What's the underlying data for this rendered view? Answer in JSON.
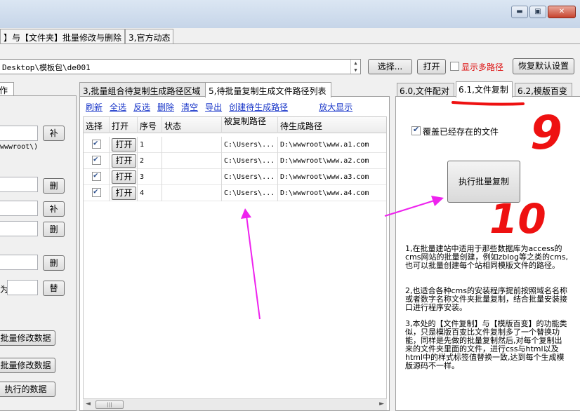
{
  "window": {
    "minimize": "▬",
    "restore": "▣",
    "close": "✕"
  },
  "main_tabs": [
    "】与【文件夹】批量修改与删除",
    "3,官方动态"
  ],
  "path": {
    "value": "Desktop\\模板包\\de001",
    "select_label": "选择...",
    "open_label": "打开",
    "multi_path_label": "显示多路径",
    "reset_label": "恢复默认设置"
  },
  "left": {
    "tab_label": "作",
    "hint": "wwwroot\\)",
    "btn_supplement": "补",
    "btn_delete": "删",
    "btn_replace": "替",
    "label_wei": "为",
    "btn_batch_modify_1": "批量修改数据",
    "btn_batch_modify_2": "批量修改数据",
    "btn_exec": "执行的数据"
  },
  "center": {
    "tabs": [
      "3,批量组合待复制生成路径区域",
      "5,待批量复制生成文件路径列表"
    ],
    "links": [
      "刷新",
      "全选",
      "反选",
      "删除",
      "清空",
      "导出",
      "创建待生成路径",
      "放大显示"
    ],
    "columns": [
      "选择",
      "打开",
      "序号",
      "状态",
      "被复制路径",
      "待生成路径"
    ],
    "rows": [
      {
        "checked": true,
        "open": "打开",
        "index": "1",
        "status": "",
        "src": "C:\\Users\\...",
        "dst": "D:\\wwwroot\\www.a1.com"
      },
      {
        "checked": true,
        "open": "打开",
        "index": "2",
        "status": "",
        "src": "C:\\Users\\...",
        "dst": "D:\\wwwroot\\www.a2.com"
      },
      {
        "checked": true,
        "open": "打开",
        "index": "3",
        "status": "",
        "src": "C:\\Users\\...",
        "dst": "D:\\wwwroot\\www.a3.com"
      },
      {
        "checked": true,
        "open": "打开",
        "index": "4",
        "status": "",
        "src": "C:\\Users\\...",
        "dst": "D:\\wwwroot\\www.a4.com"
      }
    ]
  },
  "right": {
    "tabs": [
      "6.0,文件配对",
      "6.1,文件复制",
      "6.2,模版百变"
    ],
    "overwrite_label": "覆盖已经存在的文件",
    "exec_button": "执行批量复制",
    "paragraphs": [
      "1,在批量建站中适用于那些数据库为access的cms网站的批量创建，例如zblog等之类的cms,也可以批量创建每个站相同模版文件的路径。",
      "2,也适合各种cms的安装程序提前按照域名名称或者数字名称文件夹批量复制，结合批量安装接口进行程序安装。",
      "3,本处的【文件复制】与【模版百变】的功能类似，只是模版百变比文件复制多了一个替换功能，同样是先做的批量复制然后,对每个复制出来的文件夹里面的文件，进行css与html以及html中的样式标签值替换一致,达到每个生成模版源码不一样。"
    ]
  },
  "annotations": {
    "nine": "9",
    "ten": "10",
    "mark_color": "#ee1111",
    "arrow_color": "#ee22ee"
  }
}
